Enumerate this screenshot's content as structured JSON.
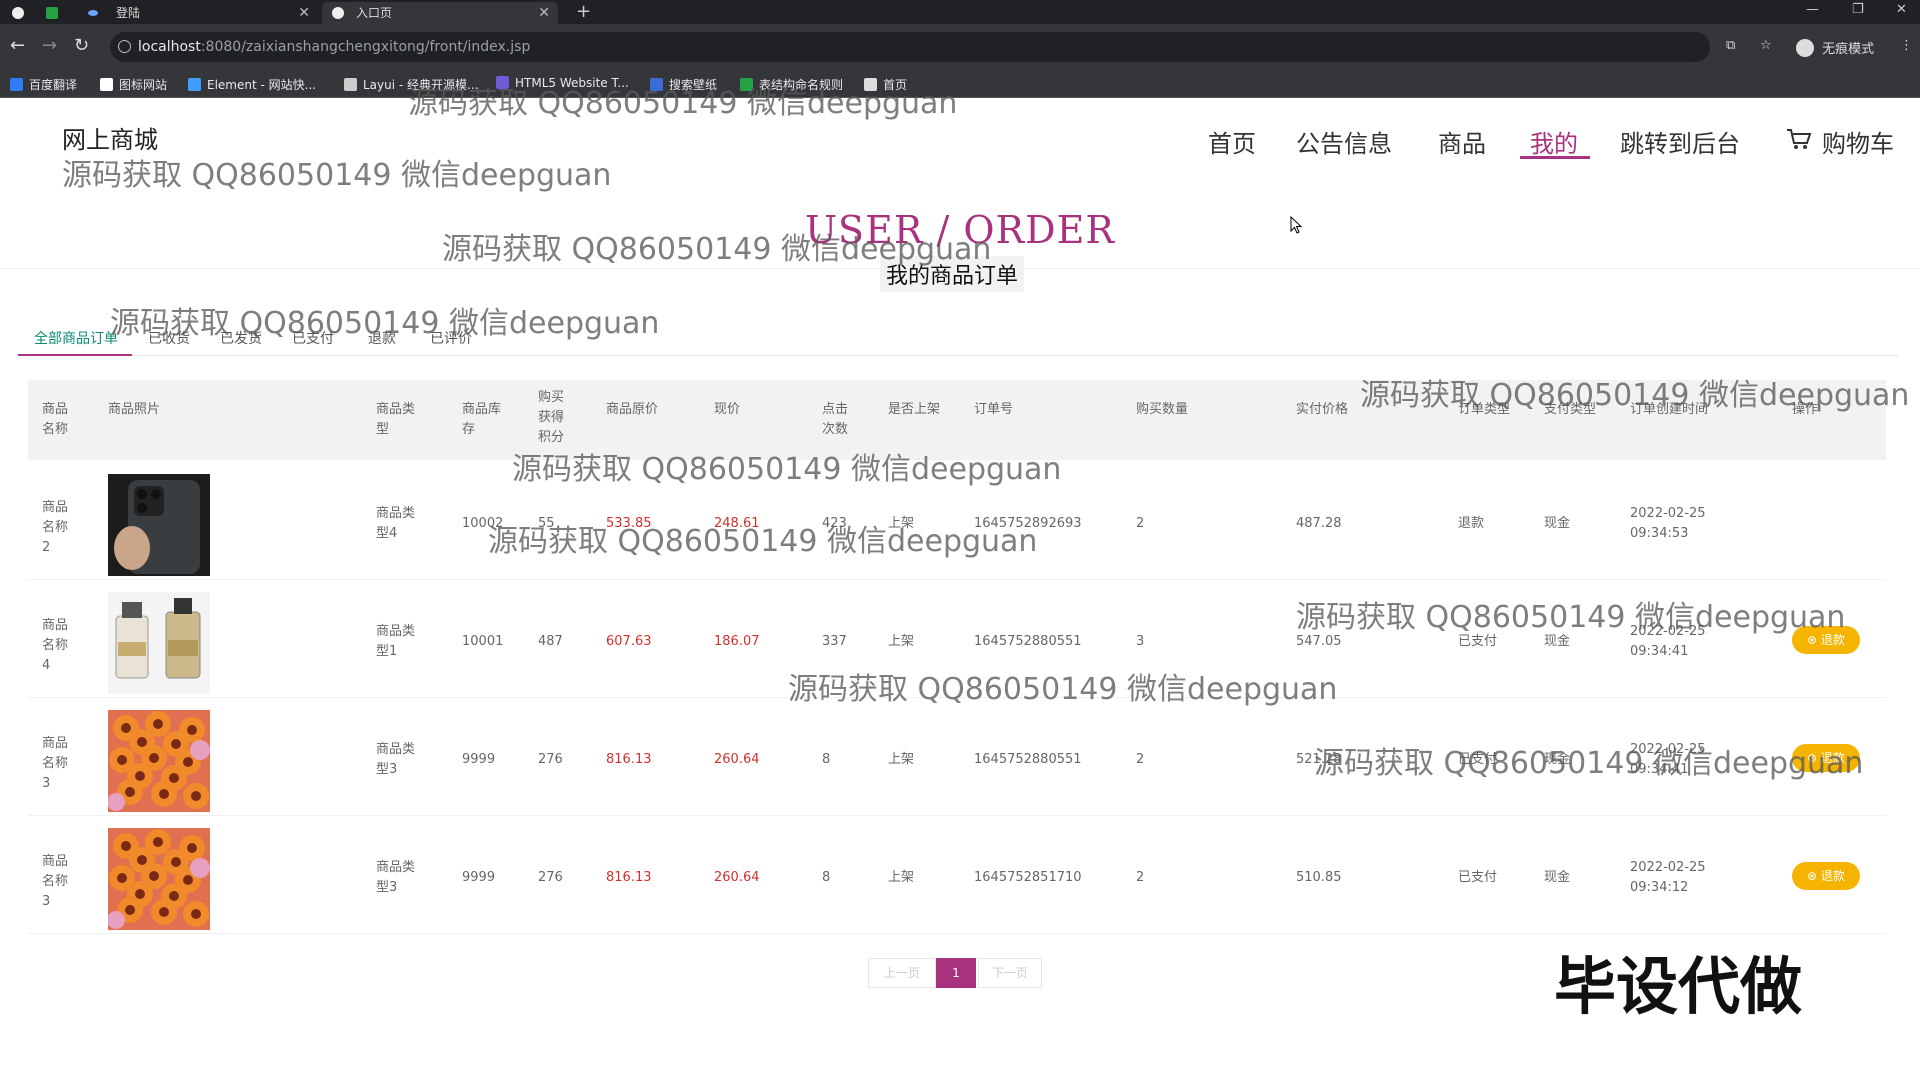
{
  "browser": {
    "tabs": [
      {
        "label": "登陆"
      },
      {
        "label": "入口页"
      }
    ],
    "url_host": "localhost",
    "url_path": ":8080/zaixianshangchengxitong/front/index.jsp",
    "incognito_label": "无痕模式",
    "bookmarks": [
      {
        "label": "百度翻译",
        "color": "#2f7bf5"
      },
      {
        "label": "图标网站",
        "color": "#ffffff"
      },
      {
        "label": "Element - 网站快...",
        "color": "#409eff"
      },
      {
        "label": "Layui - 经典开源模...",
        "color": "#cccccc"
      },
      {
        "label": "HTML5 Website T...",
        "color": "#6f5bd6"
      },
      {
        "label": "搜索壁纸",
        "color": "#3b6bd6"
      },
      {
        "label": "表结构命名规则",
        "color": "#25a244"
      },
      {
        "label": "首页",
        "color": "#dddddd"
      }
    ]
  },
  "header": {
    "logo": "网上商城",
    "nav": [
      "首页",
      "公告信息",
      "商品",
      "我的",
      "跳转到后台"
    ],
    "cart_label": "购物车"
  },
  "section": {
    "title": "USER / ORDER",
    "subtitle": "我的商品订单"
  },
  "order_tabs": [
    "全部商品订单",
    "已收货",
    "已发货",
    "已支付",
    "退款",
    "已评价"
  ],
  "table": {
    "headers": [
      "商品名称",
      "商品照片",
      "商品类型",
      "商品库存",
      "购买获得积分",
      "商品原价",
      "现价",
      "点击次数",
      "是否上架",
      "订单号",
      "购买数量",
      "实付价格",
      "订单类型",
      "支付类型",
      "订单创建时间",
      "操作"
    ],
    "rows": [
      {
        "name": "商品名称2",
        "type": "商品类型4",
        "stock": "10002",
        "points": "55",
        "orig": "533.85",
        "now": "248.61",
        "clicks": "423",
        "shelf": "上架",
        "order_no": "1645752892693",
        "qty": "2",
        "paid": "487.28",
        "otype": "退款",
        "ptype": "现金",
        "date": "2022-02-25",
        "time": "09:34:53",
        "action": "",
        "img": "phone"
      },
      {
        "name": "商品名称4",
        "type": "商品类型1",
        "stock": "10001",
        "points": "487",
        "orig": "607.63",
        "now": "186.07",
        "clicks": "337",
        "shelf": "上架",
        "order_no": "1645752880551",
        "qty": "3",
        "paid": "547.05",
        "otype": "已支付",
        "ptype": "现金",
        "date": "2022-02-25",
        "time": "09:34:41",
        "action": "退款",
        "img": "bottles"
      },
      {
        "name": "商品名称3",
        "type": "商品类型3",
        "stock": "9999",
        "points": "276",
        "orig": "816.13",
        "now": "260.64",
        "clicks": "8",
        "shelf": "上架",
        "order_no": "1645752880551",
        "qty": "2",
        "paid": "521.28",
        "otype": "已支付",
        "ptype": "现金",
        "date": "2022-02-25",
        "time": "09:34:41",
        "action": "退款",
        "img": "flowers"
      },
      {
        "name": "商品名称3",
        "type": "商品类型3",
        "stock": "9999",
        "points": "276",
        "orig": "816.13",
        "now": "260.64",
        "clicks": "8",
        "shelf": "上架",
        "order_no": "1645752851710",
        "qty": "2",
        "paid": "510.85",
        "otype": "已支付",
        "ptype": "现金",
        "date": "2022-02-25",
        "time": "09:34:12",
        "action": "退款",
        "img": "flowers"
      }
    ]
  },
  "pager": {
    "prev": "上一页",
    "current": "1",
    "next": "下一页"
  },
  "watermark": "源码获取 QQ86050149 微信deepguan",
  "big_watermark": "毕设代做",
  "colors": {
    "accent": "#a8327d",
    "price": "#d0312d",
    "refund": "#f5b400",
    "active_tab_text": "#0a8a74"
  }
}
